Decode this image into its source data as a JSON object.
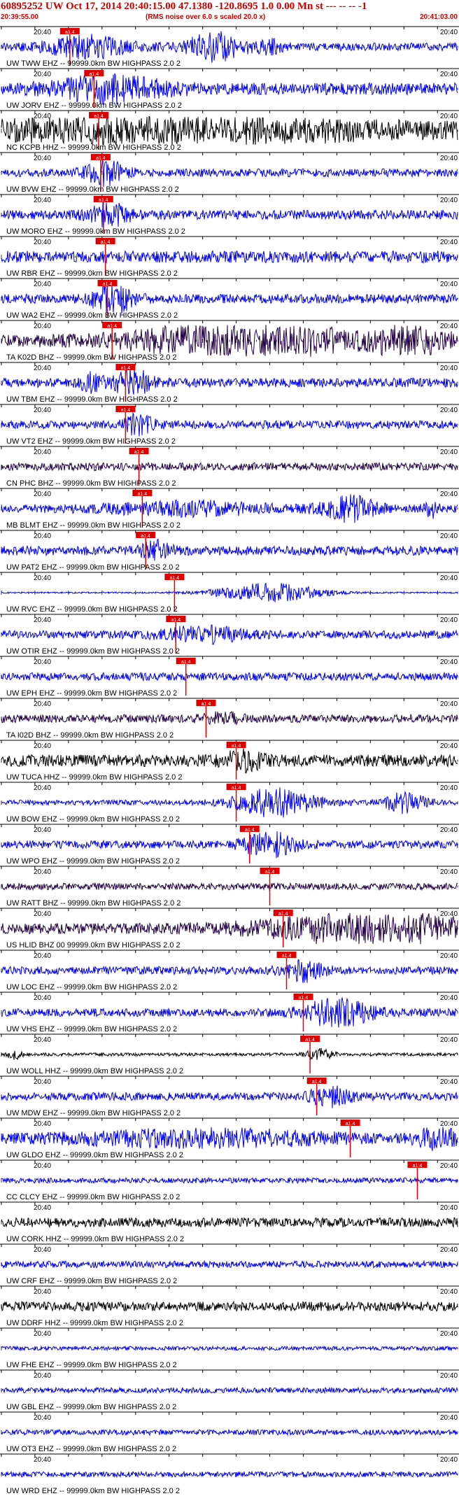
{
  "header": {
    "title": "60895252 UW Oct 17, 2014 20:40:15.00   47.1380 -120.8695  1.0 0.00 Mn st --- -- --   -1",
    "start_time": "20:39:55.00",
    "note": "(RMS noise over 6.0 s scaled 20.0 x)",
    "end_time": "20:41:03.00"
  },
  "colors": {
    "header": "#cc0000",
    "pick": "#dd0000",
    "wave_blue": "#0000ee",
    "wave_dark": "#220044",
    "wave_black": "#000000"
  },
  "chart_data": {
    "type": "line",
    "x_range_seconds": [
      0,
      68
    ],
    "tick_interval_seconds": 5,
    "trace_time_label": "20:40",
    "traces": [
      {
        "label": "UW TWW EHZ -- 99999.0km BW  HIGHPASS  2.0  2",
        "pick_label": "a1.4",
        "pick_s": 10.2,
        "color": "blue",
        "noise": 0.3,
        "events": [
          [
            13,
            6,
            0.7
          ],
          [
            32,
            4,
            1.0
          ],
          [
            40,
            2,
            0.4
          ]
        ]
      },
      {
        "label": "UW JORV EHZ -- 99999.0km BW  HIGHPASS  2.0  2",
        "pick_label": "a1.4",
        "pick_s": 13.8,
        "color": "blue",
        "noise": 0.45,
        "events": [
          [
            16,
            8,
            0.8
          ]
        ]
      },
      {
        "label": "NC KCPB HHZ -- 99999.0km BW  HIGHPASS  2.0  2",
        "pick_label": "a1.4",
        "pick_s": 14.5,
        "color": "black",
        "noise": 0.6,
        "events": [
          [
            25,
            40,
            0.5
          ]
        ]
      },
      {
        "label": "UW BVW EHZ -- 99999.0km BW  HIGHPASS  2.0  2",
        "pick_label": "a1.4",
        "pick_s": 14.8,
        "color": "blue",
        "noise": 0.3,
        "events": [
          [
            15.5,
            3,
            0.8
          ]
        ]
      },
      {
        "label": "UW MORO EHZ -- 99999.0km BW  HIGHPASS  2.0  2",
        "pick_label": "a1.4",
        "pick_s": 15.2,
        "color": "blue",
        "noise": 0.35,
        "events": [
          [
            16,
            3,
            0.7
          ]
        ]
      },
      {
        "label": "UW RBR EHZ -- 99999.0km BW  HIGHPASS  2.0  2",
        "pick_label": "a1.4",
        "pick_s": 15.5,
        "color": "blue",
        "noise": 0.45,
        "events": []
      },
      {
        "label": "UW WA2 EHZ -- 99999.0km BW  HIGHPASS  2.0  2",
        "pick_label": "a1.4",
        "pick_s": 15.8,
        "color": "blue",
        "noise": 0.35,
        "events": [
          [
            16.5,
            3,
            1.0
          ]
        ]
      },
      {
        "label": "TA K02D BHZ -- 99999.0km BW  HIGHPASS  2.0  2",
        "pick_label": "a1.4",
        "pick_s": 16.5,
        "color": "dark",
        "noise": 0.5,
        "events": [
          [
            32,
            12,
            1.0
          ],
          [
            46,
            4,
            0.8
          ],
          [
            60,
            6,
            0.9
          ]
        ]
      },
      {
        "label": "UW TBM EHZ -- 99999.0km BW  HIGHPASS  2.0  2",
        "pick_label": "a1.4",
        "pick_s": 18.5,
        "color": "blue",
        "noise": 0.35,
        "events": [
          [
            13.5,
            1.5,
            0.6
          ],
          [
            19.5,
            2.5,
            1.0
          ]
        ]
      },
      {
        "label": "UW VT2 EHZ -- 99999.0km BW  HIGHPASS  2.0  2",
        "pick_label": "a1.4",
        "pick_s": 18.5,
        "color": "blue",
        "noise": 0.3,
        "events": [
          [
            20.5,
            2,
            0.7
          ]
        ]
      },
      {
        "label": "CN PHC BHZ -- 99999.0km BW  HIGHPASS  2.0  2",
        "pick_label": "a1.4",
        "pick_s": 20.5,
        "color": "dark",
        "noise": 0.3,
        "events": []
      },
      {
        "label": "MB BLMT EHZ -- 99999.0km BW  HIGHPASS  2.0  2",
        "pick_label": "a1.4",
        "pick_s": 21.0,
        "color": "blue",
        "noise": 0.3,
        "events": [
          [
            28,
            12,
            0.4
          ],
          [
            52,
            4,
            0.8
          ],
          [
            64,
            1,
            0.6
          ]
        ]
      },
      {
        "label": "UW PAT2 EHZ -- 99999.0km BW  HIGHPASS  2.0  2",
        "pick_label": "a1.4",
        "pick_s": 21.5,
        "color": "blue",
        "noise": 0.35,
        "events": [
          [
            23,
            2,
            0.6
          ]
        ]
      },
      {
        "label": "UW RVC EHZ -- 99999.0km BW  HIGHPASS  2.0  2",
        "pick_label": "a1.4",
        "pick_s": 25.8,
        "color": "blue",
        "noise": 0.05,
        "events": [
          [
            40,
            8,
            0.7
          ]
        ]
      },
      {
        "label": "UW OTIR EHZ -- 99999.0km BW  HIGHPASS  2.0  2",
        "pick_label": "a1.4",
        "pick_s": 26.0,
        "color": "blue",
        "noise": 0.3,
        "events": [
          [
            30,
            6,
            0.5
          ]
        ]
      },
      {
        "label": "UW EPH EHZ -- 99999.0km BW  HIGHPASS  2.0  2",
        "pick_label": "a1.4",
        "pick_s": 27.5,
        "color": "blue",
        "noise": 0.3,
        "events": []
      },
      {
        "label": "TA I02D BHZ -- 99999.0km BW  HIGHPASS  2.0  2",
        "pick_label": "a1.4",
        "pick_s": 30.5,
        "color": "dark",
        "noise": 0.3,
        "events": [
          [
            33,
            3,
            0.3
          ]
        ]
      },
      {
        "label": "UW TUCA HHZ -- 99999.0km BW  HIGHPASS  2.0  2",
        "pick_label": "a1.4",
        "pick_s": 35.0,
        "color": "black",
        "noise": 0.45,
        "events": [
          [
            36,
            3,
            0.5
          ]
        ]
      },
      {
        "label": "UW BOW EHZ -- 99999.0km BW  HIGHPASS  2.0  2",
        "pick_label": "a1.4",
        "pick_s": 35.0,
        "color": "blue",
        "noise": 0.2,
        "events": [
          [
            41,
            6,
            1.0
          ],
          [
            60,
            3,
            0.7
          ]
        ]
      },
      {
        "label": "UW WPO EHZ -- 99999.0km BW  HIGHPASS  2.0  2",
        "pick_label": "a1.4",
        "pick_s": 37.0,
        "color": "blue",
        "noise": 0.3,
        "events": [
          [
            40,
            4,
            0.8
          ]
        ]
      },
      {
        "label": "UW RATT BHZ -- 99999.0km BW  HIGHPASS  2.0  2",
        "pick_label": "a1.4",
        "pick_s": 40.0,
        "color": "dark",
        "noise": 0.25,
        "events": []
      },
      {
        "label": "US HLID BHZ 00 99999.0km BW  HIGHPASS  2.0  2",
        "pick_label": "a1.4",
        "pick_s": 42.0,
        "color": "dark",
        "noise": 0.4,
        "events": [
          [
            55,
            16,
            1.0
          ]
        ]
      },
      {
        "label": "UW LOC EHZ -- 99999.0km BW  HIGHPASS  2.0  2",
        "pick_label": "a1.4",
        "pick_s": 42.5,
        "color": "blue",
        "noise": 0.3,
        "events": [
          [
            45,
            3,
            0.7
          ]
        ]
      },
      {
        "label": "UW VHS EHZ -- 99999.0km BW  HIGHPASS  2.0  2",
        "pick_label": "a1.4",
        "pick_s": 45.0,
        "color": "blue",
        "noise": 0.3,
        "events": [
          [
            50,
            5,
            1.0
          ]
        ]
      },
      {
        "label": "UW WOLL HHZ -- 99999.0km BW  HIGHPASS  2.0  2",
        "pick_label": "a1.4",
        "pick_s": 46.0,
        "color": "black",
        "noise": 0.12,
        "events": [
          [
            47.5,
            2,
            0.4
          ],
          [
            2,
            1,
            0.3
          ]
        ]
      },
      {
        "label": "UW MDW EHZ -- 99999.0km BW  HIGHPASS  2.0  2",
        "pick_label": "a1.4",
        "pick_s": 47.0,
        "color": "blue",
        "noise": 0.3,
        "events": [
          [
            49,
            3,
            0.6
          ]
        ]
      },
      {
        "label": "UW GLDO EHZ -- 99999.0km BW  HIGHPASS  2.0  2",
        "pick_label": "a1.4",
        "pick_s": 52.0,
        "color": "blue",
        "noise": 0.35,
        "events": [
          [
            30,
            20,
            0.5
          ],
          [
            65,
            3,
            0.7
          ]
        ]
      },
      {
        "label": "CC CLCY EHZ -- 99999.0km BW  HIGHPASS  2.0  2",
        "pick_label": "a1.4",
        "pick_s": 62.0,
        "color": "blue",
        "noise": 0.2,
        "events": []
      },
      {
        "label": "UW CORK HHZ -- 99999.0km BW  HIGHPASS  2.0  2",
        "pick_label": "",
        "pick_s": null,
        "color": "black",
        "noise": 0.35,
        "events": []
      },
      {
        "label": "UW CRF EHZ -- 99999.0km BW  HIGHPASS  2.0  2",
        "pick_label": "",
        "pick_s": null,
        "color": "blue",
        "noise": 0.25,
        "events": []
      },
      {
        "label": "UW DDRF HHZ -- 99999.0km BW  HIGHPASS  2.0  2",
        "pick_label": "",
        "pick_s": null,
        "color": "black",
        "noise": 0.35,
        "events": []
      },
      {
        "label": "UW FHE EHZ -- 99999.0km BW  HIGHPASS  2.0  2",
        "pick_label": "",
        "pick_s": null,
        "color": "blue",
        "noise": 0.15,
        "events": []
      },
      {
        "label": "UW GBL EHZ -- 99999.0km BW  HIGHPASS  2.0  2",
        "pick_label": "",
        "pick_s": null,
        "color": "blue",
        "noise": 0.2,
        "events": []
      },
      {
        "label": "UW OT3 EHZ -- 99999.0km BW  HIGHPASS  2.0  2",
        "pick_label": "",
        "pick_s": null,
        "color": "blue",
        "noise": 0.2,
        "events": []
      },
      {
        "label": "UW WRD EHZ -- 99999.0km BW  HIGHPASS  2.0  2",
        "pick_label": "",
        "pick_s": null,
        "color": "blue",
        "noise": 0.2,
        "events": []
      }
    ]
  }
}
